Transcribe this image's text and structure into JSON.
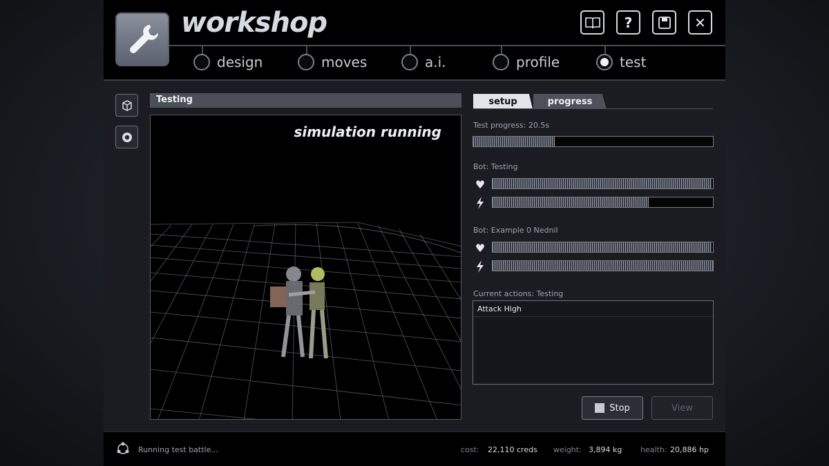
{
  "header": {
    "title": "workshop",
    "logo_icon": "wrench-icon",
    "buttons": [
      {
        "name": "manual-button",
        "icon": "book-icon"
      },
      {
        "name": "help-button",
        "label": "?"
      },
      {
        "name": "save-button",
        "icon": "floppy-icon"
      },
      {
        "name": "close-button",
        "label": "✕"
      }
    ]
  },
  "nav": {
    "tabs": [
      {
        "label": "design",
        "selected": false
      },
      {
        "label": "moves",
        "selected": false
      },
      {
        "label": "a.i.",
        "selected": false
      },
      {
        "label": "profile",
        "selected": false
      },
      {
        "label": "test",
        "selected": true
      }
    ]
  },
  "viewport": {
    "title": "Testing",
    "overlay_text": "simulation running"
  },
  "panel": {
    "tabs": [
      {
        "label": "setup",
        "active": true
      },
      {
        "label": "progress",
        "active": false
      }
    ],
    "test_progress_label": "Test progress: 20.5s",
    "test_progress": 0.34,
    "bot1": {
      "label": "Bot: Testing",
      "health": 0.995,
      "energy": 0.71
    },
    "bot2": {
      "label": "Bot: Example 0 Nednil",
      "health": 0.995,
      "energy": 1.0
    },
    "current_actions_label": "Current actions: Testing",
    "actions": [
      "Attack High"
    ],
    "stop_label": "Stop",
    "view_label": "View"
  },
  "status": {
    "message": "Running test battle...",
    "cost_key": "cost:",
    "cost_val": "22,110 creds",
    "weight_key": "weight:",
    "weight_val": "3,894 kg",
    "health_key": "health:",
    "health_val": "20,886 hp"
  },
  "colors": {
    "accent": "#e2e4e9",
    "panel_bg": "#1a1c22",
    "header_bg": "#000000"
  }
}
